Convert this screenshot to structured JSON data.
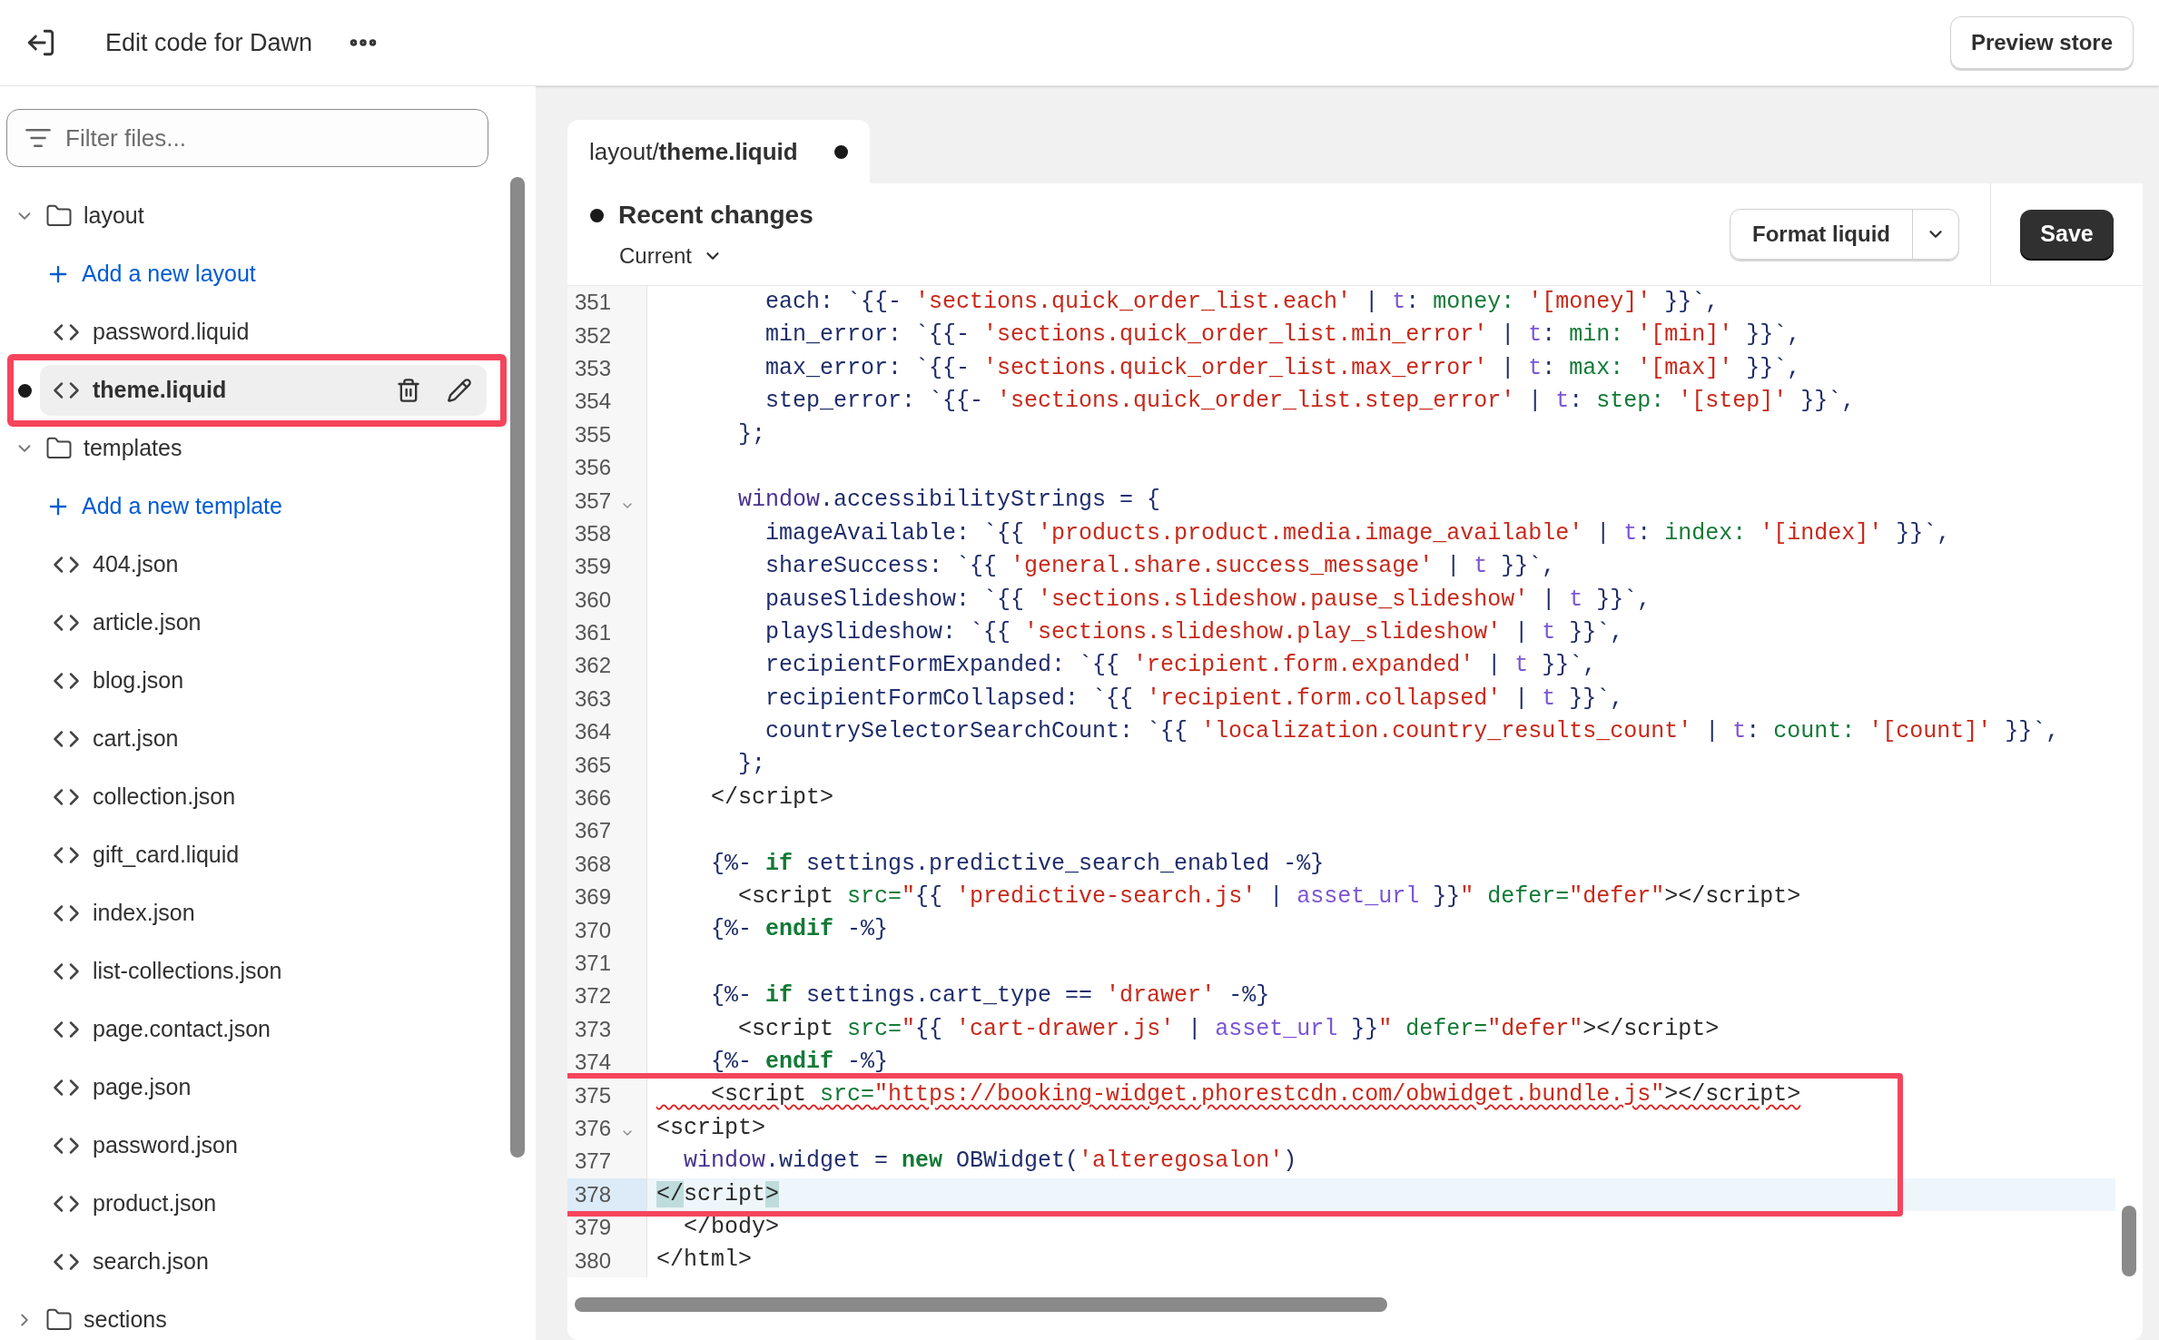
{
  "header": {
    "title": "Edit code for Dawn",
    "preview_button": "Preview store"
  },
  "sidebar": {
    "filter": {
      "placeholder": "Filter files..."
    },
    "tree": [
      {
        "kind": "folder",
        "label": "layout",
        "expanded": true,
        "children": [
          {
            "kind": "add",
            "label": "Add a new layout"
          },
          {
            "kind": "file",
            "label": "password.liquid",
            "selected": false,
            "modified": false,
            "annotated": false
          },
          {
            "kind": "file",
            "label": "theme.liquid",
            "selected": true,
            "modified": true,
            "annotated": true
          }
        ]
      },
      {
        "kind": "folder",
        "label": "templates",
        "expanded": true,
        "children": [
          {
            "kind": "add",
            "label": "Add a new template"
          },
          {
            "kind": "file",
            "label": "404.json",
            "selected": false,
            "modified": false,
            "annotated": false
          },
          {
            "kind": "file",
            "label": "article.json",
            "selected": false,
            "modified": false,
            "annotated": false
          },
          {
            "kind": "file",
            "label": "blog.json",
            "selected": false,
            "modified": false,
            "annotated": false
          },
          {
            "kind": "file",
            "label": "cart.json",
            "selected": false,
            "modified": false,
            "annotated": false
          },
          {
            "kind": "file",
            "label": "collection.json",
            "selected": false,
            "modified": false,
            "annotated": false
          },
          {
            "kind": "file",
            "label": "gift_card.liquid",
            "selected": false,
            "modified": false,
            "annotated": false
          },
          {
            "kind": "file",
            "label": "index.json",
            "selected": false,
            "modified": false,
            "annotated": false
          },
          {
            "kind": "file",
            "label": "list-collections.json",
            "selected": false,
            "modified": false,
            "annotated": false
          },
          {
            "kind": "file",
            "label": "page.contact.json",
            "selected": false,
            "modified": false,
            "annotated": false
          },
          {
            "kind": "file",
            "label": "page.json",
            "selected": false,
            "modified": false,
            "annotated": false
          },
          {
            "kind": "file",
            "label": "password.json",
            "selected": false,
            "modified": false,
            "annotated": false
          },
          {
            "kind": "file",
            "label": "product.json",
            "selected": false,
            "modified": false,
            "annotated": false
          },
          {
            "kind": "file",
            "label": "search.json",
            "selected": false,
            "modified": false,
            "annotated": false
          }
        ]
      },
      {
        "kind": "folder",
        "label": "sections",
        "expanded": false
      }
    ]
  },
  "editor": {
    "tabs": [
      {
        "label": "layout/**theme.liquid**",
        "selected": true,
        "modified": true
      }
    ],
    "recent_changes": {
      "title": "Recent changes",
      "version": "Current"
    },
    "format_button": "Format liquid",
    "save_button": "Save",
    "code": {
      "lines": [
        {
          "number": "351",
          "fold": false,
          "current": false,
          "error": false,
          "boxed": false,
          "tokens": [
            {
              "kind": "n",
              "text": "        each: `{{- "
            },
            {
              "kind": "s",
              "text": "'sections.quick_order_list.each'"
            },
            {
              "kind": "n",
              "text": " | "
            },
            {
              "kind": "f",
              "text": "t"
            },
            {
              "kind": "n",
              "text": ": "
            },
            {
              "kind": "g",
              "text": "money: "
            },
            {
              "kind": "s",
              "text": "'[money]'"
            },
            {
              "kind": "n",
              "text": " }}`,"
            }
          ]
        },
        {
          "number": "352",
          "fold": false,
          "current": false,
          "error": false,
          "boxed": false,
          "tokens": [
            {
              "kind": "n",
              "text": "        min_error: `{{- "
            },
            {
              "kind": "s",
              "text": "'sections.quick_order_list.min_error'"
            },
            {
              "kind": "n",
              "text": " | "
            },
            {
              "kind": "f",
              "text": "t"
            },
            {
              "kind": "n",
              "text": ": "
            },
            {
              "kind": "g",
              "text": "min: "
            },
            {
              "kind": "s",
              "text": "'[min]'"
            },
            {
              "kind": "n",
              "text": " }}`,"
            }
          ]
        },
        {
          "number": "353",
          "fold": false,
          "current": false,
          "error": false,
          "boxed": false,
          "tokens": [
            {
              "kind": "n",
              "text": "        max_error: `{{- "
            },
            {
              "kind": "s",
              "text": "'sections.quick_order_list.max_error'"
            },
            {
              "kind": "n",
              "text": " | "
            },
            {
              "kind": "f",
              "text": "t"
            },
            {
              "kind": "n",
              "text": ": "
            },
            {
              "kind": "g",
              "text": "max: "
            },
            {
              "kind": "s",
              "text": "'[max]'"
            },
            {
              "kind": "n",
              "text": " }}`,"
            }
          ]
        },
        {
          "number": "354",
          "fold": false,
          "current": false,
          "error": false,
          "boxed": false,
          "tokens": [
            {
              "kind": "n",
              "text": "        step_error: `{{- "
            },
            {
              "kind": "s",
              "text": "'sections.quick_order_list.step_error'"
            },
            {
              "kind": "n",
              "text": " | "
            },
            {
              "kind": "f",
              "text": "t"
            },
            {
              "kind": "n",
              "text": ": "
            },
            {
              "kind": "g",
              "text": "step: "
            },
            {
              "kind": "s",
              "text": "'[step]'"
            },
            {
              "kind": "n",
              "text": " }}`,"
            }
          ]
        },
        {
          "number": "355",
          "fold": false,
          "current": false,
          "error": false,
          "boxed": false,
          "tokens": [
            {
              "kind": "n",
              "text": "      };"
            }
          ]
        },
        {
          "number": "356",
          "fold": false,
          "current": false,
          "error": false,
          "boxed": false
        },
        {
          "number": "357",
          "fold": true,
          "current": false,
          "error": false,
          "boxed": false,
          "tokens": [
            {
              "kind": "p",
              "text": "      window"
            },
            {
              "kind": "n",
              "text": ".accessibilityStrings = {"
            }
          ]
        },
        {
          "number": "358",
          "fold": false,
          "current": false,
          "error": false,
          "boxed": false,
          "tokens": [
            {
              "kind": "n",
              "text": "        imageAvailable: `{{ "
            },
            {
              "kind": "s",
              "text": "'products.product.media.image_available'"
            },
            {
              "kind": "n",
              "text": " | "
            },
            {
              "kind": "f",
              "text": "t"
            },
            {
              "kind": "n",
              "text": ": "
            },
            {
              "kind": "g",
              "text": "index: "
            },
            {
              "kind": "s",
              "text": "'[index]'"
            },
            {
              "kind": "n",
              "text": " }}`,"
            }
          ]
        },
        {
          "number": "359",
          "fold": false,
          "current": false,
          "error": false,
          "boxed": false,
          "tokens": [
            {
              "kind": "n",
              "text": "        shareSuccess: `{{ "
            },
            {
              "kind": "s",
              "text": "'general.share.success_message'"
            },
            {
              "kind": "n",
              "text": " | "
            },
            {
              "kind": "f",
              "text": "t"
            },
            {
              "kind": "n",
              "text": " }}`,"
            }
          ]
        },
        {
          "number": "360",
          "fold": false,
          "current": false,
          "error": false,
          "boxed": false,
          "tokens": [
            {
              "kind": "n",
              "text": "        pauseSlideshow: `{{ "
            },
            {
              "kind": "s",
              "text": "'sections.slideshow.pause_slideshow'"
            },
            {
              "kind": "n",
              "text": " | "
            },
            {
              "kind": "f",
              "text": "t"
            },
            {
              "kind": "n",
              "text": " }}`,"
            }
          ]
        },
        {
          "number": "361",
          "fold": false,
          "current": false,
          "error": false,
          "boxed": false,
          "tokens": [
            {
              "kind": "n",
              "text": "        playSlideshow: `{{ "
            },
            {
              "kind": "s",
              "text": "'sections.slideshow.play_slideshow'"
            },
            {
              "kind": "n",
              "text": " | "
            },
            {
              "kind": "f",
              "text": "t"
            },
            {
              "kind": "n",
              "text": " }}`,"
            }
          ]
        },
        {
          "number": "362",
          "fold": false,
          "current": false,
          "error": false,
          "boxed": false,
          "tokens": [
            {
              "kind": "n",
              "text": "        recipientFormExpanded: `{{ "
            },
            {
              "kind": "s",
              "text": "'recipient.form.expanded'"
            },
            {
              "kind": "n",
              "text": " | "
            },
            {
              "kind": "f",
              "text": "t"
            },
            {
              "kind": "n",
              "text": " }}`,"
            }
          ]
        },
        {
          "number": "363",
          "fold": false,
          "current": false,
          "error": false,
          "boxed": false,
          "tokens": [
            {
              "kind": "n",
              "text": "        recipientFormCollapsed: `{{ "
            },
            {
              "kind": "s",
              "text": "'recipient.form.collapsed'"
            },
            {
              "kind": "n",
              "text": " | "
            },
            {
              "kind": "f",
              "text": "t"
            },
            {
              "kind": "n",
              "text": " }}`,"
            }
          ]
        },
        {
          "number": "364",
          "fold": false,
          "current": false,
          "error": false,
          "boxed": false,
          "tokens": [
            {
              "kind": "n",
              "text": "        countrySelectorSearchCount: `{{ "
            },
            {
              "kind": "s",
              "text": "'localization.country_results_count'"
            },
            {
              "kind": "n",
              "text": " | "
            },
            {
              "kind": "f",
              "text": "t"
            },
            {
              "kind": "n",
              "text": ": "
            },
            {
              "kind": "g",
              "text": "count: "
            },
            {
              "kind": "s",
              "text": "'[count]'"
            },
            {
              "kind": "n",
              "text": " }}`,"
            }
          ]
        },
        {
          "number": "365",
          "fold": false,
          "current": false,
          "error": false,
          "boxed": false,
          "tokens": [
            {
              "kind": "n",
              "text": "      };"
            }
          ]
        },
        {
          "number": "366",
          "fold": false,
          "current": false,
          "error": false,
          "boxed": false,
          "tokens": [
            {
              "kind": "d",
              "text": "    </script>"
            }
          ]
        },
        {
          "number": "367",
          "fold": false,
          "current": false,
          "error": false,
          "boxed": false
        },
        {
          "number": "368",
          "fold": false,
          "current": false,
          "error": false,
          "boxed": false,
          "tokens": [
            {
              "kind": "n",
              "text": "    {%- "
            },
            {
              "kind": "k",
              "text": "if"
            },
            {
              "kind": "n",
              "text": " settings.predictive_search_enabled -%}"
            }
          ]
        },
        {
          "number": "369",
          "fold": false,
          "current": false,
          "error": false,
          "boxed": false,
          "tokens": [
            {
              "kind": "d",
              "text": "      <script "
            },
            {
              "kind": "g",
              "text": "src="
            },
            {
              "kind": "s",
              "text": "\""
            },
            {
              "kind": "n",
              "text": "{{ "
            },
            {
              "kind": "s",
              "text": "'predictive-search.js'"
            },
            {
              "kind": "n",
              "text": " | "
            },
            {
              "kind": "f",
              "text": "asset_url"
            },
            {
              "kind": "n",
              "text": " }}"
            },
            {
              "kind": "s",
              "text": "\" "
            },
            {
              "kind": "g",
              "text": "defer="
            },
            {
              "kind": "s",
              "text": "\"defer\""
            },
            {
              "kind": "d",
              "text": "></script>"
            }
          ]
        },
        {
          "number": "370",
          "fold": false,
          "current": false,
          "error": false,
          "boxed": false,
          "tokens": [
            {
              "kind": "n",
              "text": "    {%- "
            },
            {
              "kind": "k",
              "text": "endif"
            },
            {
              "kind": "n",
              "text": " -%}"
            }
          ]
        },
        {
          "number": "371",
          "fold": false,
          "current": false,
          "error": false,
          "boxed": false
        },
        {
          "number": "372",
          "fold": false,
          "current": false,
          "error": false,
          "boxed": false,
          "tokens": [
            {
              "kind": "n",
              "text": "    {%- "
            },
            {
              "kind": "k",
              "text": "if"
            },
            {
              "kind": "n",
              "text": " settings.cart_type == "
            },
            {
              "kind": "s",
              "text": "'drawer'"
            },
            {
              "kind": "n",
              "text": " -%}"
            }
          ]
        },
        {
          "number": "373",
          "fold": false,
          "current": false,
          "error": false,
          "boxed": false,
          "tokens": [
            {
              "kind": "d",
              "text": "      <script "
            },
            {
              "kind": "g",
              "text": "src="
            },
            {
              "kind": "s",
              "text": "\""
            },
            {
              "kind": "n",
              "text": "{{ "
            },
            {
              "kind": "s",
              "text": "'cart-drawer.js'"
            },
            {
              "kind": "n",
              "text": " | "
            },
            {
              "kind": "f",
              "text": "asset_url"
            },
            {
              "kind": "n",
              "text": " }}"
            },
            {
              "kind": "s",
              "text": "\" "
            },
            {
              "kind": "g",
              "text": "defer="
            },
            {
              "kind": "s",
              "text": "\"defer\""
            },
            {
              "kind": "d",
              "text": "></script>"
            }
          ]
        },
        {
          "number": "374",
          "fold": false,
          "current": false,
          "error": false,
          "boxed": false,
          "tokens": [
            {
              "kind": "n",
              "text": "    {%- "
            },
            {
              "kind": "k",
              "text": "endif"
            },
            {
              "kind": "n",
              "text": " -%}"
            }
          ]
        },
        {
          "number": "375",
          "fold": false,
          "current": false,
          "error": true,
          "boxed": true,
          "tokens": [
            {
              "kind": "d",
              "text": "    <script "
            },
            {
              "kind": "g",
              "text": "src="
            },
            {
              "kind": "s",
              "text": "\"https://booking-widget.phorestcdn.com/obwidget.bundle.js\""
            },
            {
              "kind": "d",
              "text": "></script>"
            }
          ]
        },
        {
          "number": "376",
          "fold": true,
          "current": false,
          "error": false,
          "boxed": true,
          "tokens": [
            {
              "kind": "d",
              "text": "<script>"
            }
          ]
        },
        {
          "number": "377",
          "fold": false,
          "current": false,
          "error": false,
          "boxed": true,
          "tokens": [
            {
              "kind": "p",
              "text": "  window"
            },
            {
              "kind": "n",
              "text": ".widget = "
            },
            {
              "kind": "k",
              "text": "new"
            },
            {
              "kind": "n",
              "text": " OBWidget("
            },
            {
              "kind": "s",
              "text": "'alteregosalon'"
            },
            {
              "kind": "n",
              "text": ")"
            }
          ]
        },
        {
          "number": "378",
          "fold": false,
          "current": true,
          "error": false,
          "boxed": true,
          "tokens": [
            {
              "kind": "m",
              "text": "</"
            },
            {
              "kind": "d",
              "text": "script"
            },
            {
              "kind": "m",
              "text": ">"
            }
          ]
        },
        {
          "number": "379",
          "fold": false,
          "current": false,
          "error": false,
          "boxed": false,
          "tokens": [
            {
              "kind": "d",
              "text": "  </body>"
            }
          ]
        },
        {
          "number": "380",
          "fold": false,
          "current": false,
          "error": false,
          "boxed": false,
          "tokens": [
            {
              "kind": "d",
              "text": "</html>"
            }
          ]
        }
      ]
    }
  }
}
